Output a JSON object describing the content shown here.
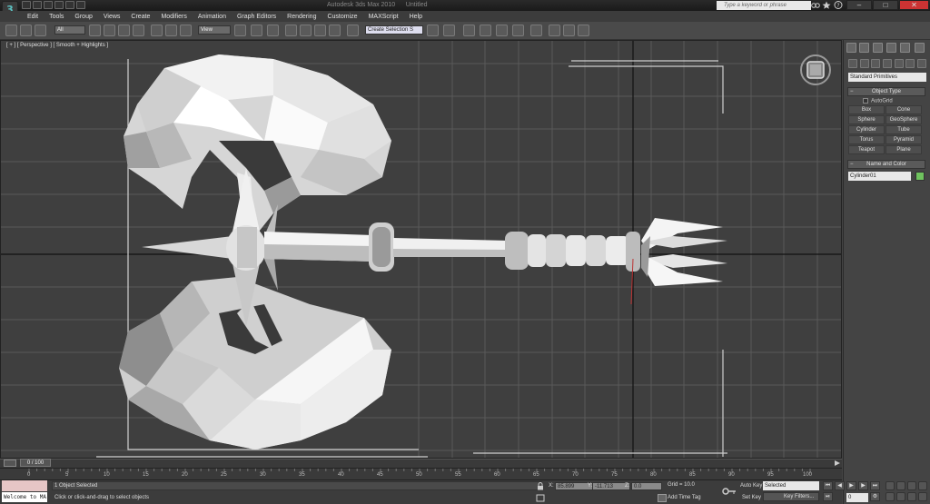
{
  "app": {
    "title": "Autodesk 3ds Max 2010",
    "file": "Untitled",
    "logo_text": "3",
    "search_placeholder": "Type a keyword or phrase",
    "win_min": "–",
    "win_max": "□",
    "win_close": "✕"
  },
  "menu": [
    "Edit",
    "Tools",
    "Group",
    "Views",
    "Create",
    "Modifiers",
    "Animation",
    "Graph Editors",
    "Rendering",
    "Customize",
    "MAXScript",
    "Help"
  ],
  "toolbar": {
    "filter": "All",
    "ref_coord": "View",
    "named_selection": "Create Selection S"
  },
  "viewport": {
    "label": "[ + ] [ Perspective ] [ Smooth + Highlights ]"
  },
  "command_panel": {
    "dropdown": "Standard Primitives",
    "object_type_title": "Object Type",
    "autogrid": "AutoGrid",
    "buttons": [
      "Box",
      "Cone",
      "Sphere",
      "GeoSphere",
      "Cylinder",
      "Tube",
      "Torus",
      "Pyramid",
      "Teapot",
      "Plane"
    ],
    "name_color_title": "Name and Color",
    "object_name": "Cylinder01",
    "object_color": "#6fc25e",
    "rollout_toggle": "−"
  },
  "timeline": {
    "frame_display": "0 / 100",
    "ticks": [
      "0",
      "5",
      "10",
      "15",
      "20",
      "25",
      "30",
      "35",
      "40",
      "45",
      "50",
      "55",
      "60",
      "65",
      "70",
      "75",
      "80",
      "85",
      "90",
      "95",
      "100"
    ]
  },
  "status": {
    "listener": "Welcome to MA",
    "selection": "1 Object Selected",
    "prompt": "Click or click-and-drag to select objects",
    "x_label": "X:",
    "x_value": "85.899",
    "y_label": "Y:",
    "y_value": "-11.713",
    "z_label": "Z:",
    "z_value": "0.0",
    "grid": "Grid = 10.0",
    "add_time_tag": "Add Time Tag",
    "auto_key": "Auto Key",
    "set_key": "Set Key",
    "selected": "Selected",
    "key_filters": "Key Filters...",
    "current_frame": "0"
  }
}
